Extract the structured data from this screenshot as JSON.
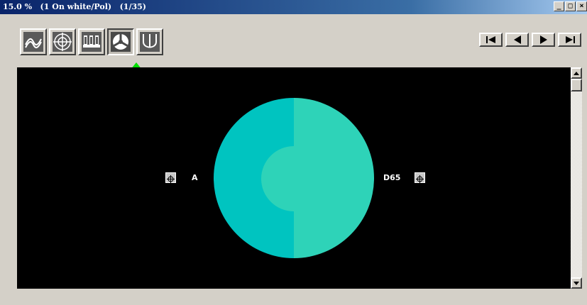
{
  "window": {
    "title": "15.0 %   (1 On white/Pol)   (1/35)",
    "minimize_glyph": "_",
    "maximize_glyph": "□",
    "close_glyph": "×"
  },
  "toolbar": {
    "tools": [
      {
        "name": "spectral-curve-view",
        "icon": "wave-curve-icon",
        "active": false
      },
      {
        "name": "target-view",
        "icon": "crosshair-target-icon",
        "active": false
      },
      {
        "name": "bar-chart-view",
        "icon": "bars-icon",
        "active": false
      },
      {
        "name": "color-patch-view",
        "icon": "pie-split-icon",
        "active": true
      },
      {
        "name": "u-curve-view",
        "icon": "u-curve-icon",
        "active": false
      }
    ]
  },
  "navigation": {
    "buttons": [
      "first",
      "previous",
      "next",
      "last"
    ]
  },
  "canvas": {
    "left_illuminant": "A",
    "right_illuminant": "D65",
    "colors": {
      "left_half": "#00c4c0",
      "right_half": "#2ed3b8",
      "background": "#000000"
    }
  },
  "colors": {
    "indicator_arrow": "#00e000",
    "titlebar_start": "#0a246a",
    "titlebar_end": "#a6caf0"
  }
}
